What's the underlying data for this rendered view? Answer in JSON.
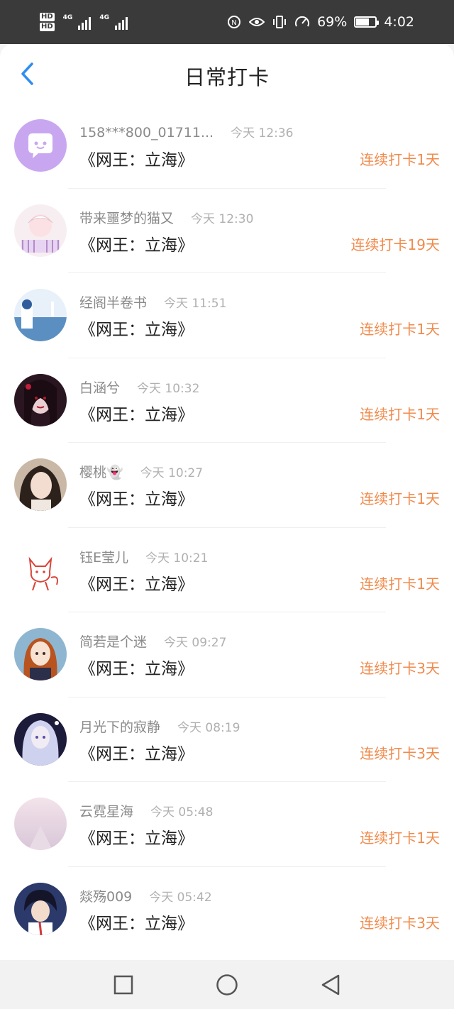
{
  "status_bar": {
    "hd1": "HD",
    "hd2": "HD",
    "net1": "4G",
    "net2": "4G",
    "battery_text": "69%",
    "battery_level": 0.69,
    "time": "4:02",
    "icons": [
      "nfc-icon",
      "eye-icon",
      "vibrate-icon",
      "speed-icon",
      "battery-icon"
    ]
  },
  "header": {
    "title": "日常打卡",
    "back_icon": "chevron-left-icon",
    "accent_color": "#2f8ef0"
  },
  "colors": {
    "streak": "#f08a4b",
    "name": "#8a8a8a",
    "time": "#b0b0b0"
  },
  "items": [
    {
      "name": "158***800_01711...",
      "time": "今天 12:36",
      "book": "《网王：立海》",
      "streak": "连续打卡1天"
    },
    {
      "name": "带来噩梦的猫又",
      "time": "今天 12:30",
      "book": "《网王：立海》",
      "streak": "连续打卡19天"
    },
    {
      "name": "经阁半卷书",
      "time": "今天 11:51",
      "book": "《网王：立海》",
      "streak": "连续打卡1天"
    },
    {
      "name": "白涵兮",
      "time": "今天 10:32",
      "book": "《网王：立海》",
      "streak": "连续打卡1天"
    },
    {
      "name": "樱桃👻",
      "time": "今天 10:27",
      "book": "《网王：立海》",
      "streak": "连续打卡1天"
    },
    {
      "name": "钰E莹儿",
      "time": "今天 10:21",
      "book": "《网王：立海》",
      "streak": "连续打卡1天"
    },
    {
      "name": "简若是个迷",
      "time": "今天 09:27",
      "book": "《网王：立海》",
      "streak": "连续打卡3天"
    },
    {
      "name": "月光下的寂静",
      "time": "今天 08:19",
      "book": "《网王：立海》",
      "streak": "连续打卡3天"
    },
    {
      "name": "云霓星海",
      "time": "今天 05:48",
      "book": "《网王：立海》",
      "streak": "连续打卡1天"
    },
    {
      "name": "燚殇009",
      "time": "今天 05:42",
      "book": "《网王：立海》",
      "streak": "连续打卡3天"
    }
  ],
  "nav": {
    "recent_icon": "square-icon",
    "home_icon": "circle-icon",
    "back_icon": "triangle-back-icon"
  }
}
